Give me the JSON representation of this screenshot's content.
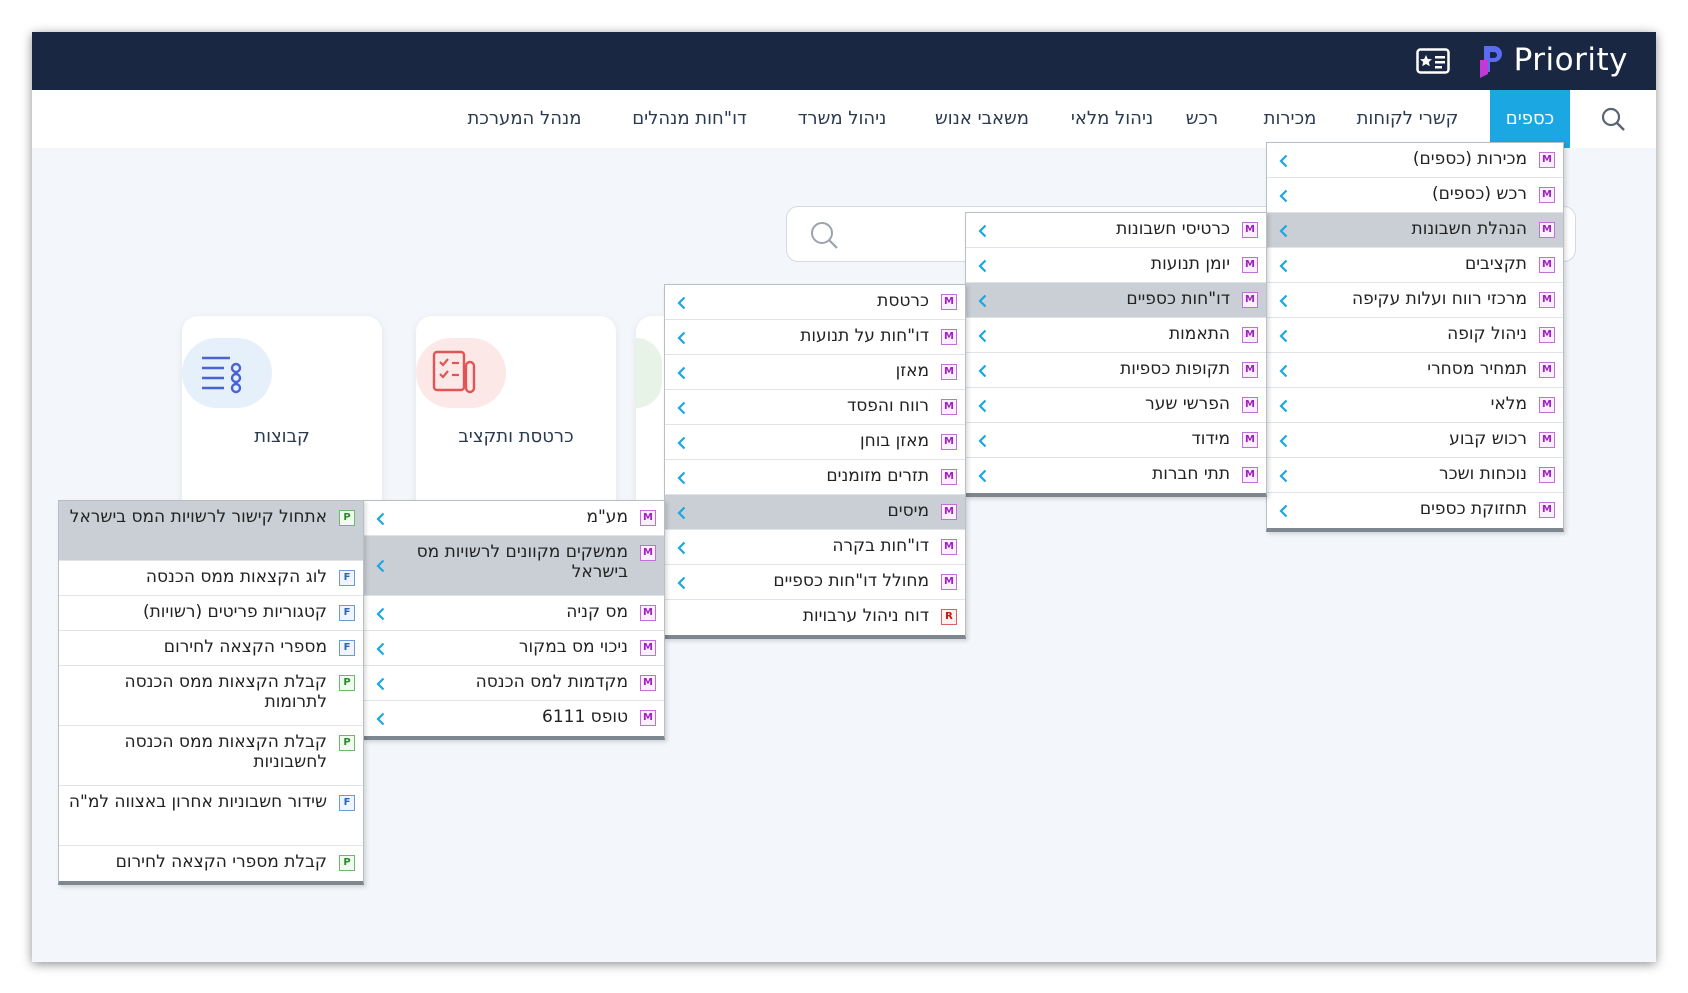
{
  "app": {
    "logo_text": "Priority"
  },
  "nav": {
    "items": [
      "כספים",
      "קשרי לקוחות",
      "מכירות",
      "רכש",
      "ניהול מלאי",
      "משאבי אנוש",
      "ניהול משרד",
      "דו\"חות מנהלים",
      "מנהל המערכת"
    ],
    "active": "כספים"
  },
  "cards": [
    {
      "label": "כרטסת ותקציב"
    },
    {
      "label": "קבוצות"
    }
  ],
  "menus": {
    "finance": [
      {
        "label": "מכירות (כספים)",
        "badge": "M"
      },
      {
        "label": "רכש (כספים)",
        "badge": "M"
      },
      {
        "label": "הנהלת חשבונות",
        "badge": "M"
      },
      {
        "label": "תקציבים",
        "badge": "M"
      },
      {
        "label": "מרכזי רווח ועלות עקיפה",
        "badge": "M"
      },
      {
        "label": "ניהול קופה",
        "badge": "M"
      },
      {
        "label": "תמחיר מסחרי",
        "badge": "M"
      },
      {
        "label": "מלאי",
        "badge": "M"
      },
      {
        "label": "רכוש קבוע",
        "badge": "M"
      },
      {
        "label": "נוכחות ושכר",
        "badge": "M"
      },
      {
        "label": "תחזוקת כספים",
        "badge": "M"
      }
    ],
    "accounting": [
      {
        "label": "כרטיסי חשבונות",
        "badge": "M"
      },
      {
        "label": "יומן תנועות",
        "badge": "M"
      },
      {
        "label": "דו\"חות כספיים",
        "badge": "M"
      },
      {
        "label": "התאמות",
        "badge": "M"
      },
      {
        "label": "תקופות כספיות",
        "badge": "M"
      },
      {
        "label": "הפרשי שער",
        "badge": "M"
      },
      {
        "label": "מידוד",
        "badge": "M"
      },
      {
        "label": "תתי חברות",
        "badge": "M"
      }
    ],
    "reports": [
      {
        "label": "כרטסת",
        "badge": "M"
      },
      {
        "label": "דו\"חות על תנועות",
        "badge": "M"
      },
      {
        "label": "מאזן",
        "badge": "M"
      },
      {
        "label": "רווח והפסד",
        "badge": "M"
      },
      {
        "label": "מאזן בוחן",
        "badge": "M"
      },
      {
        "label": "תזרים מזומנים",
        "badge": "M"
      },
      {
        "label": "מיסים",
        "badge": "M"
      },
      {
        "label": "דו\"חות בקרה",
        "badge": "M"
      },
      {
        "label": "מחולל דו\"חות כספיים",
        "badge": "M"
      },
      {
        "label": "דוח ניהול ערבויות",
        "badge": "R"
      }
    ],
    "taxes": [
      {
        "label": "מע\"מ",
        "badge": "M"
      },
      {
        "label": "ממשקים מקוונים לרשויות מס בישראל",
        "badge": "M"
      },
      {
        "label": "מס קניה",
        "badge": "M"
      },
      {
        "label": "ניכוי מס במקור",
        "badge": "M"
      },
      {
        "label": "מקדמות למס הכנסה",
        "badge": "M"
      },
      {
        "label": "טופס 6111",
        "badge": "M"
      }
    ],
    "online": [
      {
        "label": "אתחול קישור לרשויות המס בישראל",
        "badge": "P"
      },
      {
        "label": "לוג הקצאות ממס הכנסה",
        "badge": "F"
      },
      {
        "label": "קטגוריות פריטים (רשויות)",
        "badge": "F"
      },
      {
        "label": "מספרי הקצאה לחירום",
        "badge": "F"
      },
      {
        "label": "קבלת הקצאות ממס הכנסה לתרומות",
        "badge": "P"
      },
      {
        "label": "קבלת הקצאות ממס הכנסה לחשבוניות",
        "badge": "P"
      },
      {
        "label": "שידור חשבוניות אחרון באצווה למ\"ה",
        "badge": "F"
      },
      {
        "label": "קבלת מספרי הקצאה לחירום",
        "badge": "P"
      }
    ]
  }
}
